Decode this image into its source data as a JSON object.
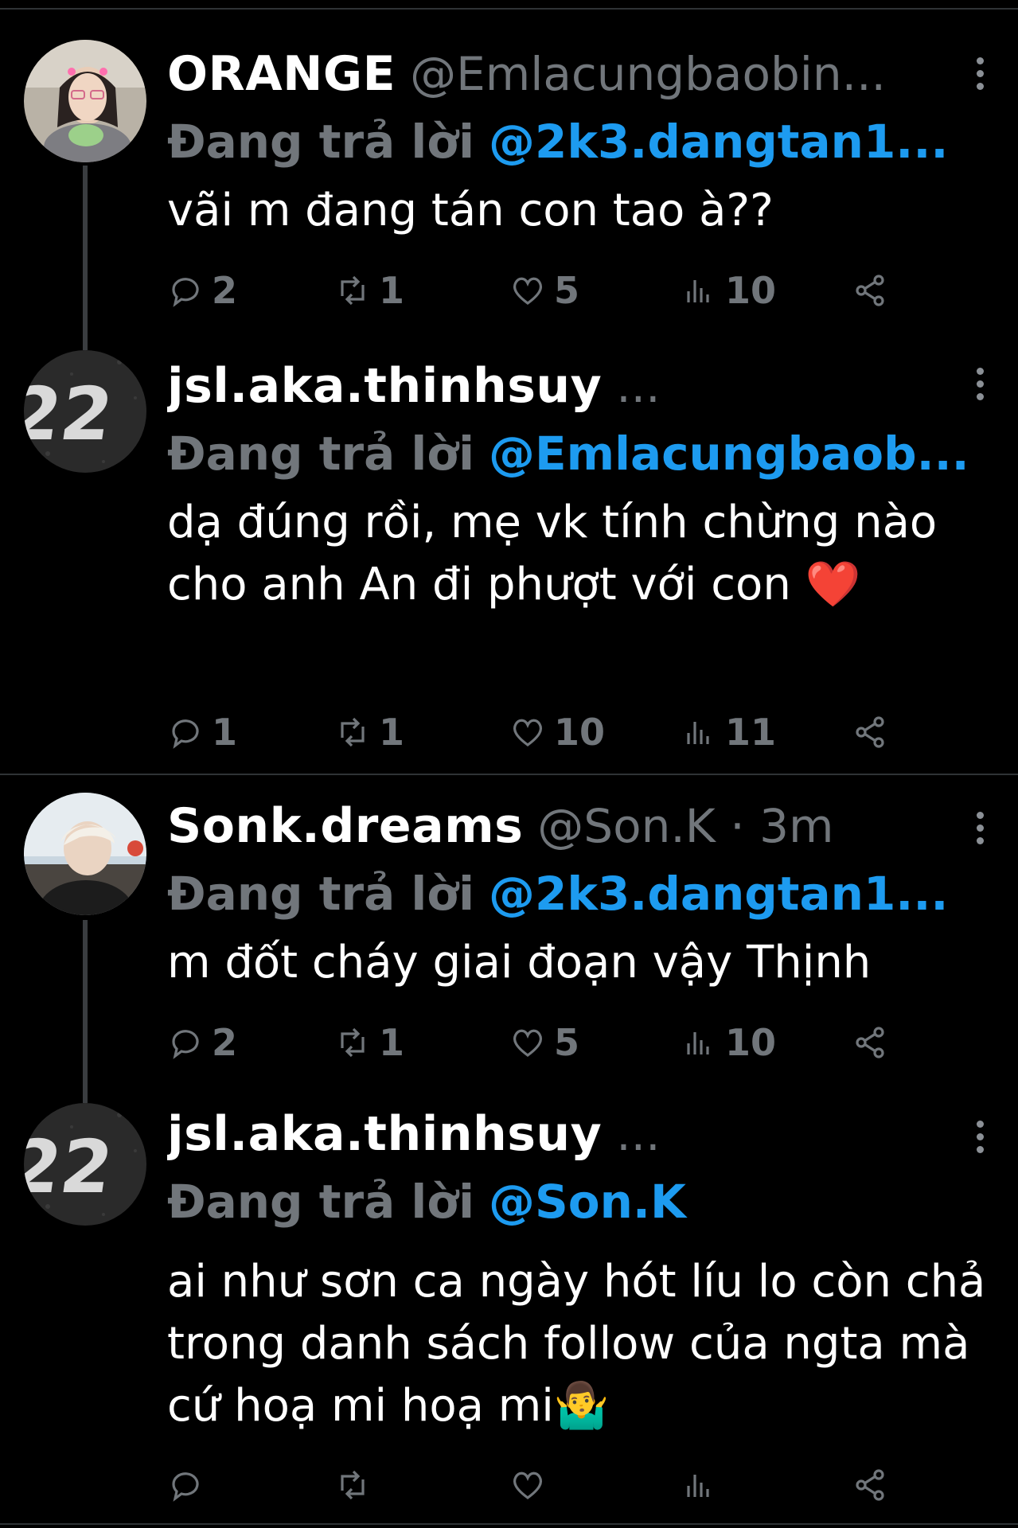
{
  "tweets": [
    {
      "display_name": "ORANGE",
      "handle": "@Emlacungbaobin...",
      "reply_label": "Đang trả lời",
      "reply_to": "@2k3.dangtan1...",
      "text": "vãi m đang tán con tao à??",
      "replies": "2",
      "reposts": "1",
      "likes": "5",
      "views": "10"
    },
    {
      "display_name": "jsl.aka.thinhsuy",
      "handle": "...",
      "reply_label": "Đang trả lời",
      "reply_to": "@Emlacungbaob...",
      "text": "dạ đúng rồi, mẹ vk tính chừng nào cho anh An đi phượt với con ❤️",
      "replies": "1",
      "reposts": "1",
      "likes": "10",
      "views": "11"
    },
    {
      "display_name": "Sonk.dreams",
      "handle": "@Son.K · 3m",
      "reply_label": "Đang trả lời",
      "reply_to": "@2k3.dangtan1...",
      "text": "m đốt cháy giai đoạn vậy Thịnh",
      "replies": "2",
      "reposts": "1",
      "likes": "5",
      "views": "10"
    },
    {
      "display_name": "jsl.aka.thinhsuy",
      "handle": "...",
      "reply_label": "Đang trả lời",
      "reply_to": "@Son.K",
      "text": "ai như sơn ca ngày hót líu lo còn chả trong danh sách follow của ngta mà cứ hoạ mi hoạ mi🤷‍♂️",
      "replies": "",
      "reposts": "",
      "likes": "",
      "views": ""
    }
  ],
  "colors": {
    "background": "#000000",
    "text": "#ffffff",
    "secondary": "#71767b",
    "mention": "#1d9bf0",
    "divider": "#2f3336"
  },
  "icons": [
    "reply-icon",
    "repost-icon",
    "like-icon",
    "views-icon",
    "share-icon",
    "more-icon"
  ]
}
